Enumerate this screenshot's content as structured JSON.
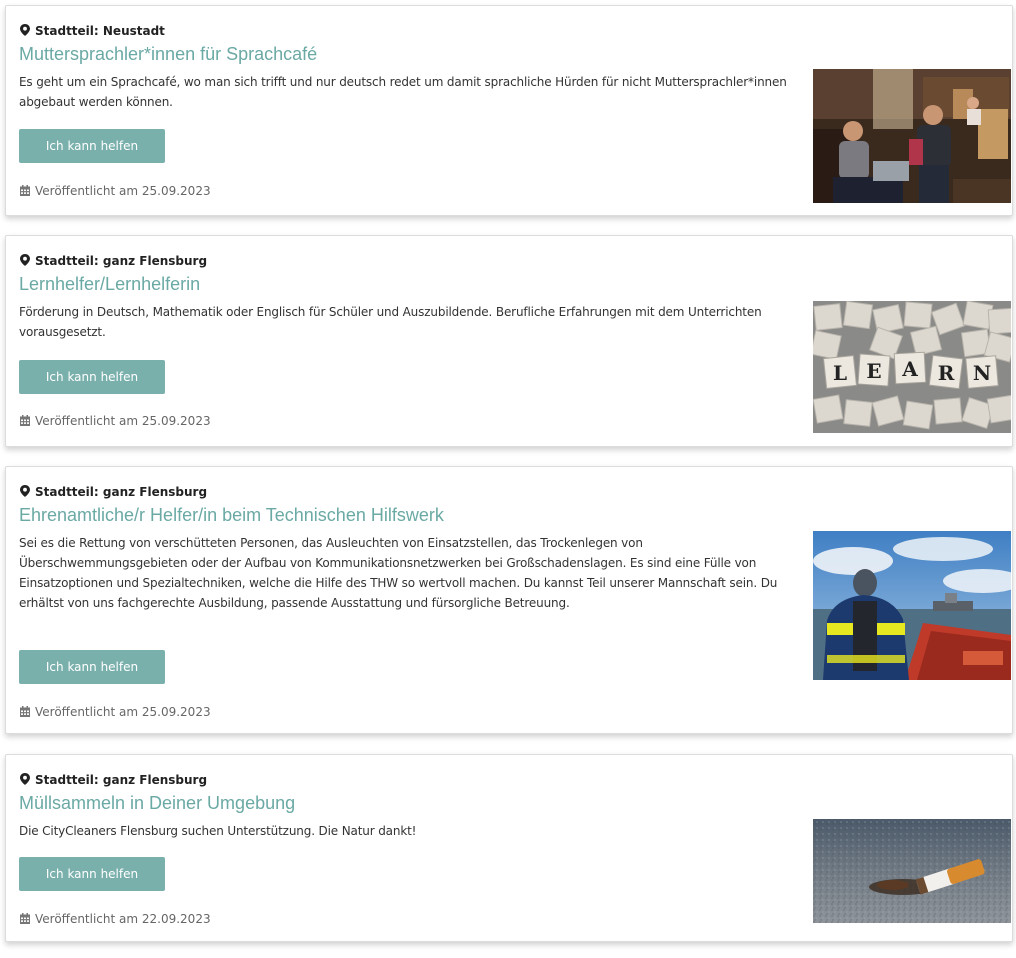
{
  "colors": {
    "title": "#6aa9a4",
    "button_bg": "#7ab0ac",
    "button_text": "#ffffff",
    "text": "#333333",
    "meta_text": "#666666"
  },
  "icons": {
    "district": "map-marker-icon",
    "published": "calendar-icon"
  },
  "offers": [
    {
      "district": "Stadtteil: Neustadt",
      "title": "Muttersprachler*innen für Sprachcafé",
      "description": "Es geht um ein Sprachcafé, wo man sich trifft und nur deutsch redet um damit sprachliche Hürden für nicht Muttersprachler*innen abgebaut werden können.",
      "button_label": "Ich kann helfen",
      "published": "Veröffentlicht am 25.09.2023",
      "image": "cafe-photo"
    },
    {
      "district": "Stadtteil: ganz Flensburg",
      "title": "Lernhelfer/Lernhelferin",
      "description": "Förderung in Deutsch, Mathematik oder Englisch für Schüler und Auszubildende. Berufliche Erfahrungen mit dem Unterrichten vorausgesetzt.",
      "button_label": "Ich kann helfen",
      "published": "Veröffentlicht am 25.09.2023",
      "image": "learn-tiles-photo",
      "image_letters": [
        "L",
        "E",
        "A",
        "R",
        "N"
      ]
    },
    {
      "district": "Stadtteil: ganz Flensburg",
      "title": "Ehrenamtliche/r Helfer/in beim Technischen Hilfswerk",
      "description": "Sei es die Rettung von verschütteten Personen, das Ausleuchten von Einsatzstellen, das Trockenlegen von Überschwemmungsgebieten oder der Aufbau von Kommunikationsnetzwerken bei Großschadenslagen. Es sind eine Fülle von Einsatzoptionen und Spezialtechniken, welche die Hilfe des THW so wertvoll machen. Du kannst Teil unserer Mannschaft sein. Du erhältst von uns fachgerechte Ausbildung, passende Ausstattung und fürsorgliche Betreuung.",
      "button_label": "Ich kann helfen",
      "published": "Veröffentlicht am 25.09.2023",
      "image": "rescue-boat-photo"
    },
    {
      "district": "Stadtteil: ganz Flensburg",
      "title": "Müllsammeln in Deiner Umgebung",
      "description": "Die CityCleaners Flensburg suchen Unterstützung. Die Natur dankt!",
      "button_label": "Ich kann helfen",
      "published": "Veröffentlicht am 22.09.2023",
      "image": "cigarette-butt-photo"
    }
  ]
}
